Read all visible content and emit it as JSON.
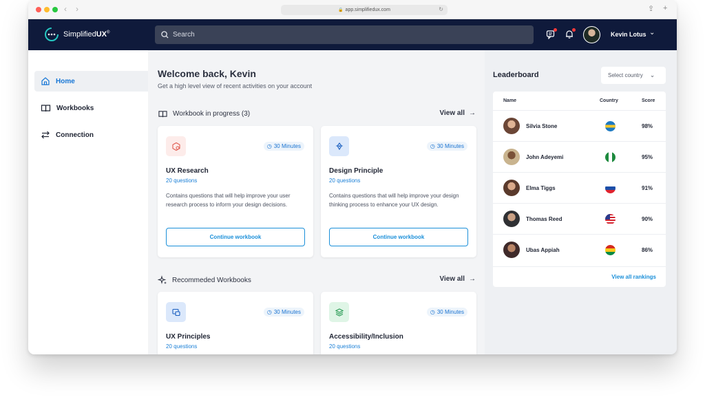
{
  "browser": {
    "url": "app.simplifiedux.com"
  },
  "topbar": {
    "logo_prefix": "Simplified",
    "logo_bold": "UX",
    "logo_mark": "®",
    "search_placeholder": "Search",
    "user_name": "Kevin Lotus"
  },
  "sidebar": {
    "items": [
      {
        "label": "Home",
        "icon": "home-icon",
        "active": true
      },
      {
        "label": "Workbooks",
        "icon": "book-icon",
        "active": false
      },
      {
        "label": "Connection",
        "icon": "arrows-swap-icon",
        "active": false
      }
    ]
  },
  "main": {
    "welcome": "Welcome back, Kevin",
    "subtitle": "Get a high level view of recent activities on your account",
    "in_progress": {
      "heading": "Workbook in progress (3)",
      "view_all": "View all",
      "cards": [
        {
          "time": "30 Minutes",
          "title": "UX Research",
          "questions": "20 questions",
          "description": "Contains questions that will help improve your user research process to inform your design decisions.",
          "button": "Continue workbook"
        },
        {
          "time": "30 Minutes",
          "title": "Design Principle",
          "questions": "20 questions",
          "description": "Contains questions that will help improve your design thinking process to enhance your UX design.",
          "button": "Continue workbook"
        }
      ]
    },
    "recommended": {
      "heading": "Recommeded Workbooks",
      "view_all": "View all",
      "cards": [
        {
          "time": "30 Minutes",
          "title": "UX Principles",
          "questions": "20 questions"
        },
        {
          "time": "30 Minutes",
          "title": "Accessibility/Inclusion",
          "questions": "20 questions"
        }
      ]
    }
  },
  "leaderboard": {
    "title": "Leaderboard",
    "select_placeholder": "Select country",
    "columns": {
      "name": "Name",
      "country": "Country",
      "score": "Score"
    },
    "rows": [
      {
        "name": "Silvia Stone",
        "score": "98%",
        "flag": "flag-bahamas"
      },
      {
        "name": "John Adeyemi",
        "score": "95%",
        "flag": "flag-nigeria"
      },
      {
        "name": "Elma Tiggs",
        "score": "91%",
        "flag": "flag-slovakia"
      },
      {
        "name": "Thomas Reed",
        "score": "90%",
        "flag": "flag-usa"
      },
      {
        "name": "Ubas Appiah",
        "score": "86%",
        "flag": "flag-ghana"
      }
    ],
    "view_all": "View all rankings"
  },
  "colors": {
    "navbar": "#0f1a3b",
    "accent_blue": "#1a8fd9",
    "active_text": "#1676d6"
  }
}
